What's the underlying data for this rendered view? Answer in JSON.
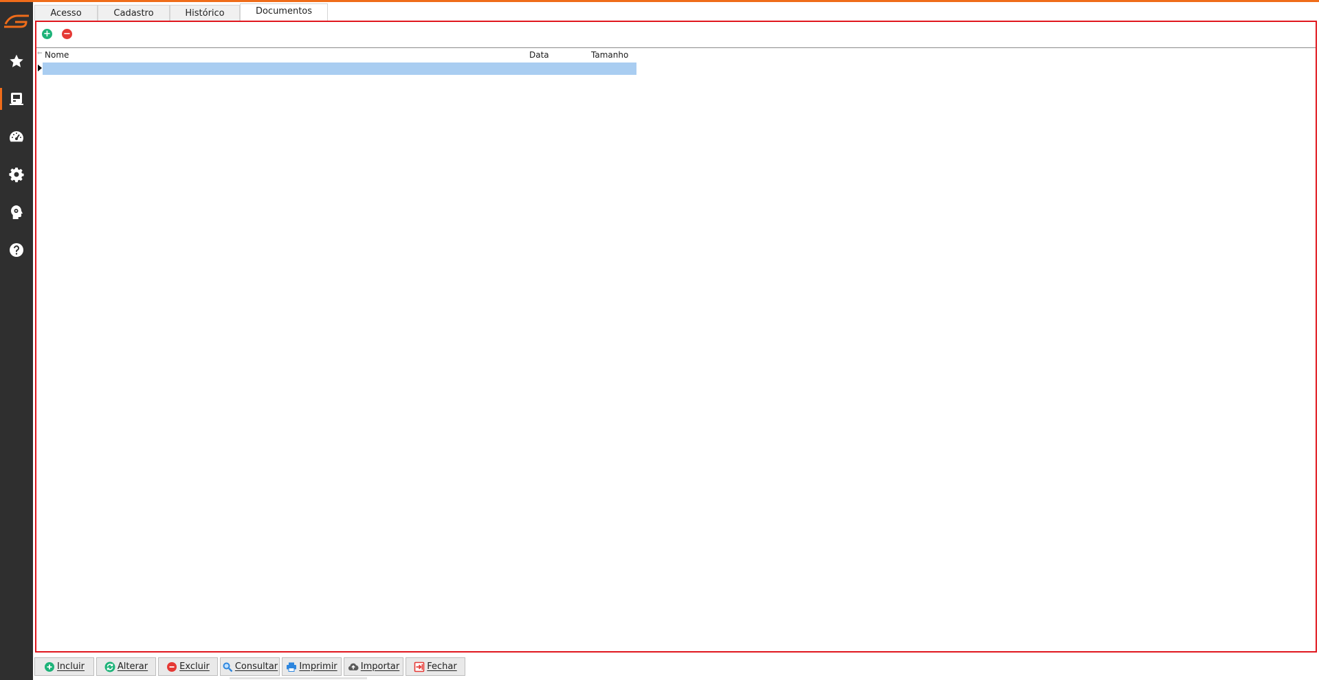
{
  "colors": {
    "accent": "#ef6c1a",
    "sidebar": "#2f2f2f",
    "panel_border": "#e0151c",
    "selection": "#a9cdf1",
    "add": "#1db379",
    "remove": "#e53935"
  },
  "sidebar": {
    "items": [
      {
        "icon": "star-icon"
      },
      {
        "icon": "id-card-icon",
        "active": true
      },
      {
        "icon": "dashboard-icon"
      },
      {
        "icon": "gear-icon"
      },
      {
        "icon": "head-gear-icon"
      },
      {
        "icon": "help-icon"
      }
    ]
  },
  "tabs": [
    {
      "label": "Acesso"
    },
    {
      "label": "Cadastro"
    },
    {
      "label": "Histórico"
    },
    {
      "label": "Documentos",
      "active": true
    }
  ],
  "panel": {
    "toolbar": {
      "add_symbol": "+",
      "remove_symbol": "−"
    },
    "grid": {
      "columns": [
        "Nome",
        "Data",
        "Tamanho"
      ],
      "rows": [
        {
          "nome": "",
          "data": "",
          "tamanho": "",
          "selected": true
        }
      ]
    }
  },
  "bottom_bar": {
    "buttons": [
      {
        "label": "Incluir",
        "icon": "plus-circle-icon"
      },
      {
        "label": "Alterar",
        "icon": "refresh-icon"
      },
      {
        "label": "Excluir",
        "icon": "minus-circle-icon"
      },
      {
        "label": "Consultar",
        "icon": "search-icon"
      },
      {
        "label": "Imprimir",
        "icon": "printer-icon"
      },
      {
        "label": "Importar",
        "icon": "cloud-upload-icon"
      },
      {
        "label": "Fechar",
        "icon": "exit-icon"
      }
    ]
  }
}
